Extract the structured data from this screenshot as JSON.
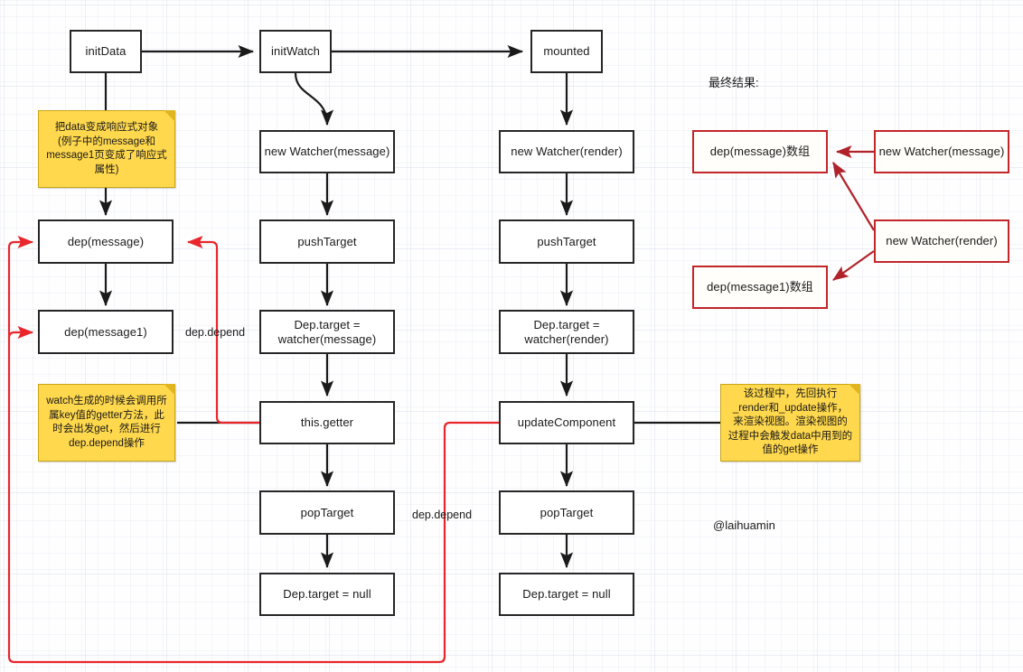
{
  "diagram": {
    "title_text": "最终结果:",
    "signature": "@laihuamin",
    "colors": {
      "node_border": "#262626",
      "red_border": "#c2262a",
      "red_arrow": "#e8262c",
      "note_fill": "#ffd84d",
      "note_border": "#c8a416",
      "background": "#fefeff"
    },
    "nodes": {
      "init_data": "initData",
      "init_watch": "initWatch",
      "mounted": "mounted",
      "dep_message": "dep(message)",
      "dep_message1": "dep(message1)",
      "new_watcher_message": "new Watcher(message)",
      "push_target_mid": "pushTarget",
      "dep_target_watcher_message": "Dep.target =\nwatcher(message)",
      "this_getter": "this.getter",
      "pop_target_mid": "popTarget",
      "dep_target_null_mid": "Dep.target = null",
      "new_watcher_render": "new Watcher(render)",
      "push_target_right": "pushTarget",
      "dep_target_watcher_render": "Dep.target =\nwatcher(render)",
      "update_component": "updateComponent",
      "pop_target_right": "popTarget",
      "dep_target_null_right": "Dep.target = null",
      "result_dep_message": "dep(message)数组",
      "result_dep_message1": "dep(message1)数组",
      "result_new_watcher_message": "new Watcher(message)",
      "result_new_watcher_render": "new Watcher(render)"
    },
    "notes": {
      "note_init_data": "把data变成响应式对象\n(例子中的message和\nmessage1页变成了响应式\n属性)",
      "note_watch_getter": "watch生成的时候会调用所\n属key值的getter方法，此\n时会出发get，然后进行\ndep.depend操作",
      "note_update_component": "该过程中，先回执行\n_render和_update操作，\n来渲染视图。渲染视图的\n过程中会触发data中用到的\n值的get操作"
    },
    "edge_labels": {
      "dep_depend_upper": "dep.depend",
      "dep_depend_lower": "dep.depend"
    }
  }
}
